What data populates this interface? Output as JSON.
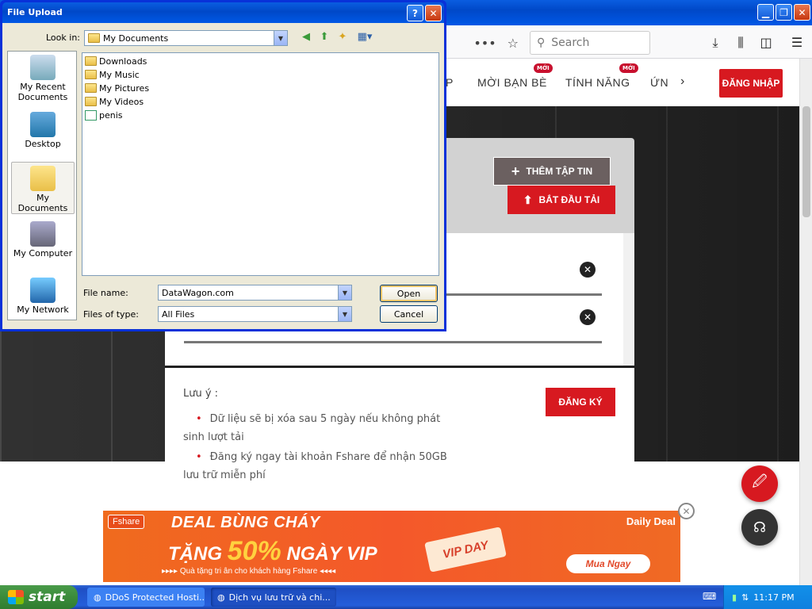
{
  "dialog": {
    "title": "File Upload",
    "look_in_label": "Look in:",
    "look_in_value": "My Documents",
    "places": [
      "My Recent Documents",
      "Desktop",
      "My Documents",
      "My Computer",
      "My Network"
    ],
    "files": [
      {
        "name": "Downloads",
        "type": "folder"
      },
      {
        "name": "My Music",
        "type": "folder"
      },
      {
        "name": "My Pictures",
        "type": "folder"
      },
      {
        "name": "My Videos",
        "type": "folder"
      },
      {
        "name": "penis",
        "type": "file"
      }
    ],
    "file_name_label": "File name:",
    "file_name_value": "DataWagon.com",
    "file_type_label": "Files of type:",
    "file_type_value": "All Files",
    "open_label": "Open",
    "cancel_label": "Cancel",
    "help_label": "?",
    "close_label": "✕"
  },
  "browser": {
    "search_placeholder": "Search",
    "url_tail_dots": "•••",
    "colors": {
      "titlebar": "#0054e3",
      "toolbar": "#f9f9fa"
    }
  },
  "nav": {
    "items": [
      "P",
      "MỜI BẠN BÈ",
      "TÍNH NĂNG",
      "ỨN"
    ],
    "badge": "MỚI",
    "login": "ĐĂNG NHẬP"
  },
  "upload": {
    "add_file": "THÊM TẬP TIN",
    "start_upload": "BẮT ĐẦU TẢI"
  },
  "notes": {
    "title": "Lưu ý :",
    "items": [
      "Dữ liệu sẽ bị xóa sau 5 ngày nếu không phát sinh lượt tải",
      "Đăng ký ngay tài khoản Fshare để nhận 50GB lưu trữ miễn phí"
    ],
    "register": "ĐĂNG KÝ"
  },
  "banner": {
    "logo": "Fshare",
    "title": "DEAL BÙNG CHÁY",
    "daily": "Daily Deal",
    "tang": "TẶNG",
    "percent": "50%",
    "ngay_vip": "NGÀY VIP",
    "vip_day": "VIP DAY",
    "sub": "▸▸▸▸ Quà tặng tri ân cho khách hàng Fshare ◂◂◂◂",
    "cta": "Mua Ngay",
    "close": "✕"
  },
  "taskbar": {
    "start": "start",
    "tasks": [
      "DDoS Protected Hosti...",
      "Dịch vụ lưu trữ và chi..."
    ],
    "clock": "11:17 PM"
  },
  "colors": {
    "accent_red": "#d71920",
    "xp_blue": "#0054e3",
    "dialog_bg": "#ece9d8"
  }
}
